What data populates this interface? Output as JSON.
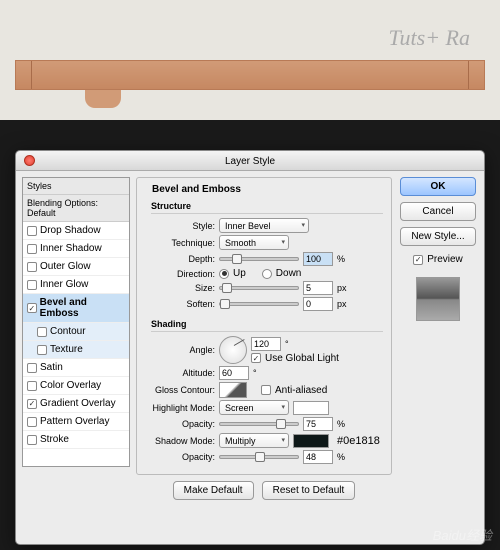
{
  "background": {
    "title_text": "Tuts+ Ra"
  },
  "dialog": {
    "title": "Layer Style",
    "styles_header": "Styles",
    "blending_header": "Blending Options: Default",
    "styles": [
      {
        "label": "Drop Shadow",
        "checked": false
      },
      {
        "label": "Inner Shadow",
        "checked": false
      },
      {
        "label": "Outer Glow",
        "checked": false
      },
      {
        "label": "Inner Glow",
        "checked": false
      },
      {
        "label": "Bevel and Emboss",
        "checked": true,
        "selected": true
      },
      {
        "label": "Contour",
        "checked": false,
        "sub": true
      },
      {
        "label": "Texture",
        "checked": false,
        "sub": true
      },
      {
        "label": "Satin",
        "checked": false
      },
      {
        "label": "Color Overlay",
        "checked": false
      },
      {
        "label": "Gradient Overlay",
        "checked": true
      },
      {
        "label": "Pattern Overlay",
        "checked": false
      },
      {
        "label": "Stroke",
        "checked": false
      }
    ],
    "bevel": {
      "title": "Bevel and Emboss",
      "structure_label": "Structure",
      "style_label": "Style:",
      "style_value": "Inner Bevel",
      "technique_label": "Technique:",
      "technique_value": "Smooth",
      "depth_label": "Depth:",
      "depth_value": "100",
      "depth_unit": "%",
      "direction_label": "Direction:",
      "up_label": "Up",
      "down_label": "Down",
      "size_label": "Size:",
      "size_value": "5",
      "size_unit": "px",
      "soften_label": "Soften:",
      "soften_value": "0",
      "soften_unit": "px",
      "shading_label": "Shading",
      "angle_label": "Angle:",
      "angle_value": "120",
      "angle_unit": "°",
      "global_light_label": "Use Global Light",
      "altitude_label": "Altitude:",
      "altitude_value": "60",
      "altitude_unit": "°",
      "gloss_label": "Gloss Contour:",
      "anti_alias_label": "Anti-aliased",
      "highlight_mode_label": "Highlight Mode:",
      "highlight_mode_value": "Screen",
      "highlight_opacity_label": "Opacity:",
      "highlight_opacity_value": "75",
      "highlight_opacity_unit": "%",
      "shadow_mode_label": "Shadow Mode:",
      "shadow_mode_value": "Multiply",
      "shadow_hex": "#0e1818",
      "shadow_opacity_label": "Opacity:",
      "shadow_opacity_value": "48",
      "shadow_opacity_unit": "%"
    },
    "buttons": {
      "make_default": "Make Default",
      "reset_default": "Reset to Default",
      "ok": "OK",
      "cancel": "Cancel",
      "new_style": "New Style...",
      "preview": "Preview"
    }
  },
  "watermark": "Baidu经验"
}
